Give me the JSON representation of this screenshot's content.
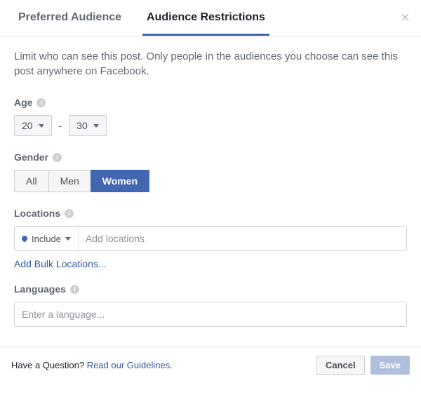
{
  "tabs": {
    "preferred": "Preferred Audience",
    "restrictions": "Audience Restrictions"
  },
  "description": "Limit who can see this post. Only people in the audiences you choose can see this post anywhere on Facebook.",
  "age": {
    "label": "Age",
    "min": "20",
    "max": "30",
    "separator": "-"
  },
  "gender": {
    "label": "Gender",
    "options": {
      "all": "All",
      "men": "Men",
      "women": "Women"
    },
    "selected": "women"
  },
  "locations": {
    "label": "Locations",
    "include_label": "Include",
    "placeholder": "Add locations",
    "bulk_link": "Add Bulk Locations..."
  },
  "languages": {
    "label": "Languages",
    "placeholder": "Enter a language..."
  },
  "footer": {
    "question": "Have a Question? ",
    "guidelines": "Read our Guidelines.",
    "cancel": "Cancel",
    "save": "Save"
  }
}
